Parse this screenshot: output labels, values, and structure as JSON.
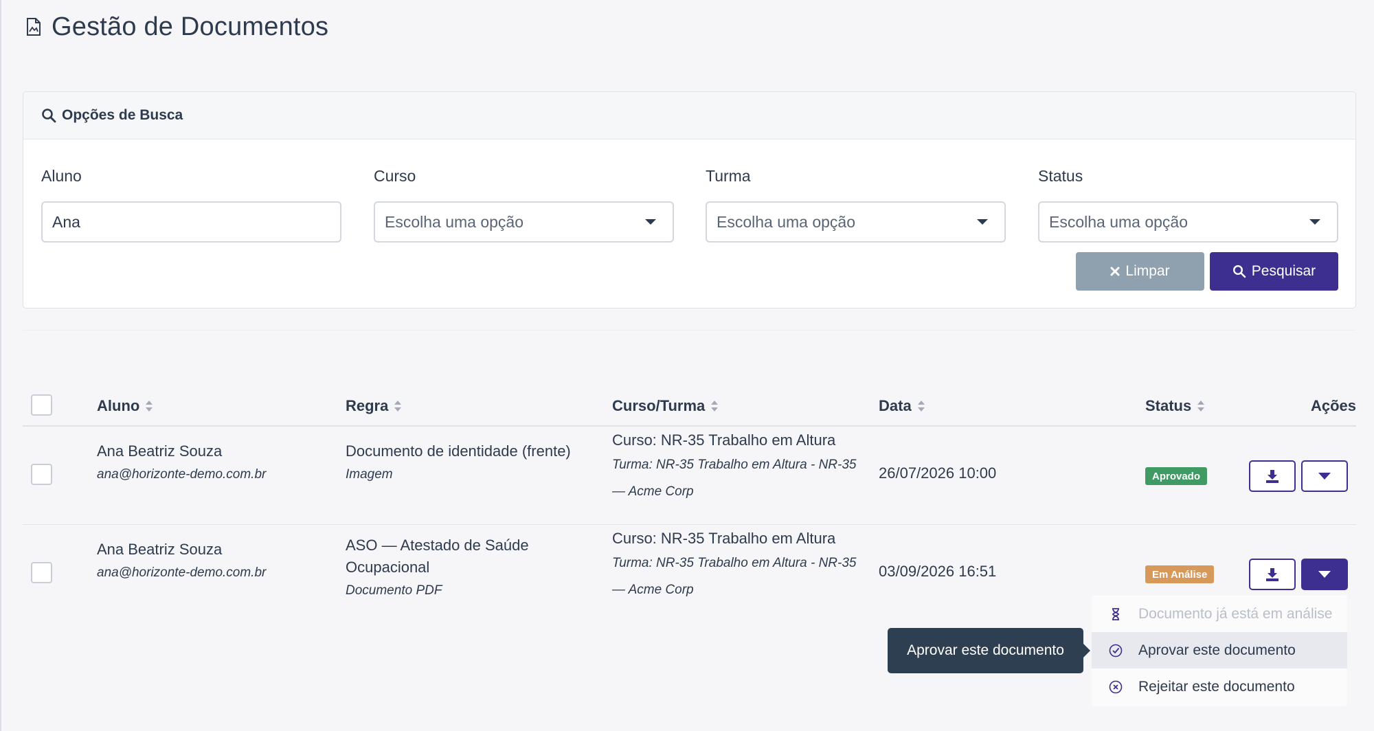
{
  "page": {
    "title": "Gestão de Documentos"
  },
  "search": {
    "header": "Opções de Busca",
    "fields": [
      {
        "label": "Aluno",
        "value": "Ana"
      },
      {
        "label": "Curso",
        "value": "Escolha uma opção"
      },
      {
        "label": "Turma",
        "value": "Escolha uma opção"
      },
      {
        "label": "Status",
        "value": "Escolha uma opção"
      }
    ],
    "clear_label": "Limpar",
    "search_label": "Pesquisar"
  },
  "table": {
    "columns": {
      "aluno": "Aluno",
      "regra": "Regra",
      "curso": "Curso/Turma",
      "data": "Data",
      "status": "Status",
      "acoes": "Ações"
    },
    "rows": [
      {
        "name": "Ana Beatriz Souza",
        "email": "ana@horizonte-demo.com.br",
        "rule": "Documento de identidade (frente)",
        "rule_line2": "",
        "rule_type": "Imagem",
        "course": "Curso: NR-35 Trabalho em Altura",
        "class_line1": "Turma: NR-35 Trabalho em Altura - NR-35",
        "class_line2": "— Acme Corp",
        "date": "26/07/2026 10:00",
        "status": "Aprovado",
        "status_color": "#3f9a64"
      },
      {
        "name": "Ana Beatriz Souza",
        "email": "ana@horizonte-demo.com.br",
        "rule": "ASO — Atestado de Saúde",
        "rule_line2": "Ocupacional",
        "rule_type": "Documento PDF",
        "course": "Curso: NR-35 Trabalho em Altura",
        "class_line1": "Turma: NR-35 Trabalho em Altura - NR-35",
        "class_line2": "— Acme Corp",
        "date": "03/09/2026 16:51",
        "status": "Em Análise",
        "status_color": "#d7995a"
      }
    ]
  },
  "dropdown": {
    "items": [
      {
        "label": "Documento já está em análise",
        "icon": "hourglass-icon",
        "disabled": true
      },
      {
        "label": "Aprovar este documento",
        "icon": "check-circle-icon",
        "disabled": false
      },
      {
        "label": "Rejeitar este documento",
        "icon": "x-circle-icon",
        "disabled": false
      }
    ]
  },
  "tooltip": {
    "text": "Aprovar este documento"
  },
  "colors": {
    "primary": "#3c2f8f",
    "clear_button": "#8fa0af",
    "text": "#2e3a4d"
  }
}
